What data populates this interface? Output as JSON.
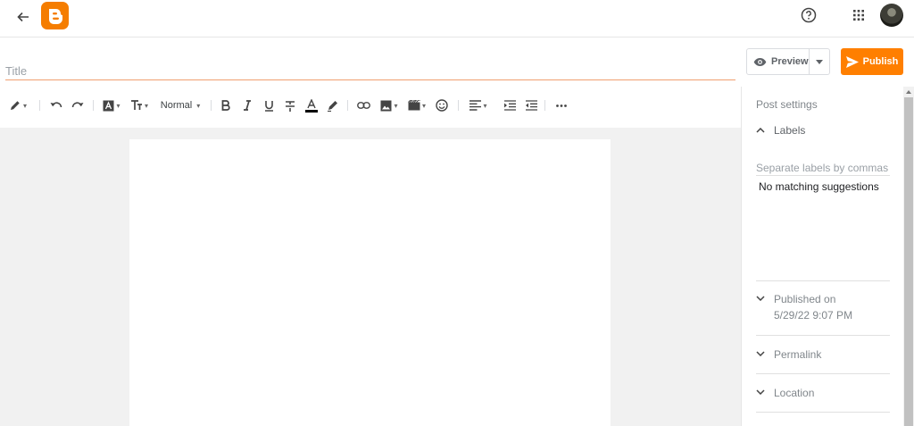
{
  "topbar": {
    "back_icon": "arrow-left-icon",
    "logo_icon": "blogger-logo",
    "help_icon": "help-circle-icon",
    "apps_icon": "apps-grid-icon",
    "avatar_icon": "user-avatar"
  },
  "editor": {
    "title_placeholder": "Title",
    "preview_label": "Preview",
    "publish_label": "Publish",
    "format_label": "Normal"
  },
  "sidebar": {
    "heading": "Post settings",
    "labels_title": "Labels",
    "labels_placeholder": "Separate labels by commas",
    "no_suggestions": "No matching suggestions",
    "published_label": "Published on",
    "published_date": "5/29/22 9:07 PM",
    "permalink_label": "Permalink",
    "location_label": "Location"
  },
  "colors": {
    "accent": "#ff7f00",
    "logo": "#f57d00",
    "editor_bg": "#f1f1f1"
  }
}
